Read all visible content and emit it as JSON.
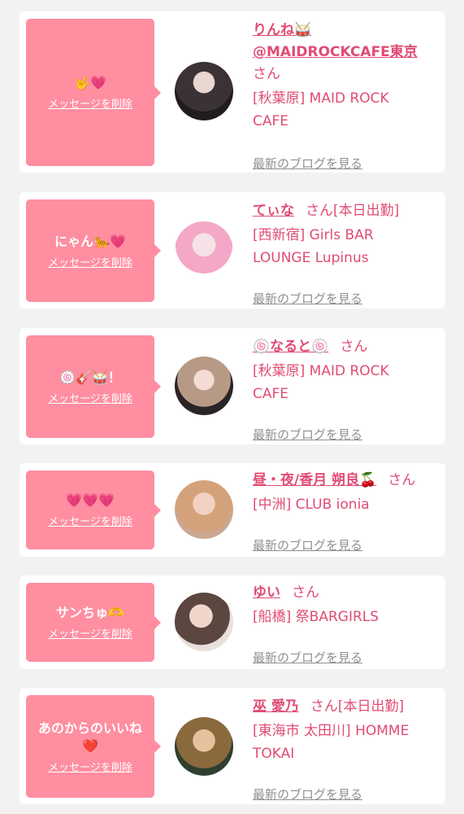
{
  "delete_label": "メッセージを削除",
  "blog_label": "最新のブログを見る",
  "san_label": "さん",
  "cards": [
    {
      "message": "🤟💗",
      "name_line1": "りんね🥁",
      "name_line2": "@MAIDROCKCAFE東京",
      "status": "",
      "shop_line1": "[秋葉原] MAID ROCK",
      "shop_line2": "CAFE"
    },
    {
      "message": "にゃん🐆💗",
      "name_line1": "てぃな",
      "name_line2": "",
      "status": "[本日出勤]",
      "shop_line1": "[西新宿] Girls BAR",
      "shop_line2": "LOUNGE Lupinus"
    },
    {
      "message": "🍥🎸🥁！",
      "name_line1": "🍥なると🍥",
      "name_line2": "",
      "status": "",
      "shop_line1": "[秋葉原] MAID ROCK",
      "shop_line2": "CAFE"
    },
    {
      "message": "💗💗💗",
      "name_line1": "昼・夜/香月 朔良🍒",
      "name_line2": "",
      "status": "",
      "shop_line1": "[中洲] CLUB ionia",
      "shop_line2": ""
    },
    {
      "message": "サンちゅ🫶",
      "name_line1": "ゆい",
      "name_line2": "",
      "status": "",
      "shop_line1": "[船橋] 祭BARGIRLS",
      "shop_line2": ""
    },
    {
      "message": "あのからのいいね\n❤️",
      "name_line1": "巫 愛乃",
      "name_line2": "",
      "status": "[本日出勤]",
      "shop_line1": "[東海市 太田川] HOMME",
      "shop_line2": "TOKAI"
    }
  ]
}
